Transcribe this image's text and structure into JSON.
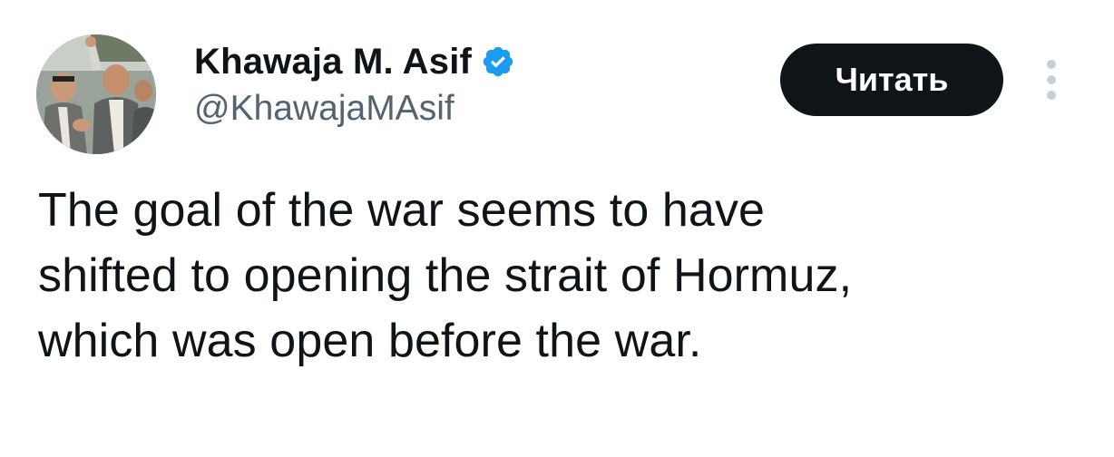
{
  "author": {
    "display_name": "Khawaja M. Asif",
    "handle": "@KhawajaMAsif",
    "verified": true,
    "verified_color": "#1d9bf0"
  },
  "actions": {
    "follow_label": "Читать"
  },
  "tweet": {
    "lines": [
      "The goal of the war seems to have",
      "shifted to opening the strait of Hormuz,",
      "which was open before the war."
    ]
  },
  "colors": {
    "text": "#0f1419",
    "secondary": "#536471",
    "button_bg": "#0f1419",
    "more_dots": "#c4cfd6"
  }
}
